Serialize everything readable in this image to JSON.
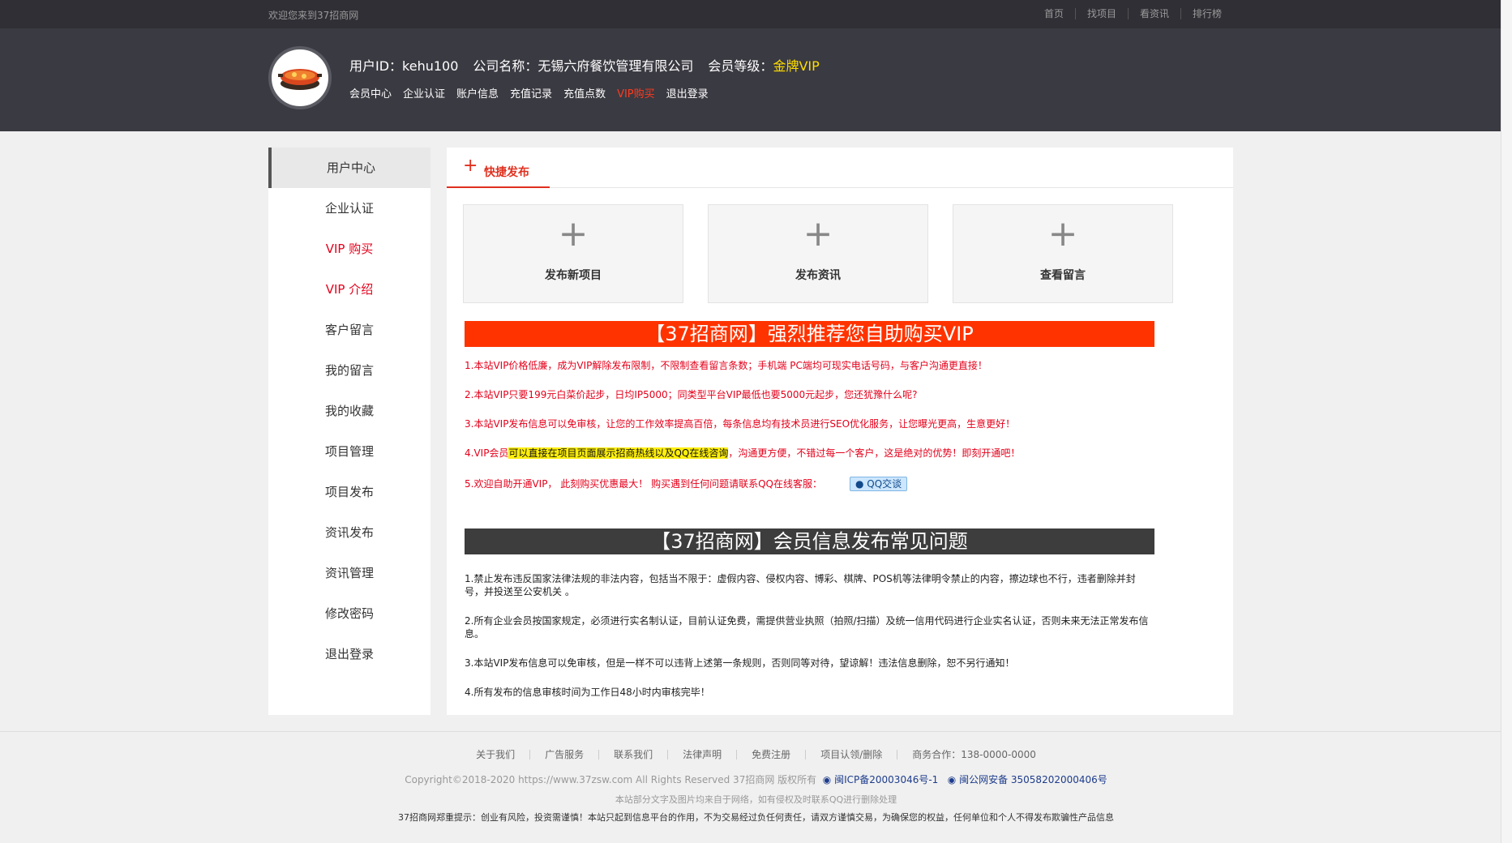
{
  "topbar": {
    "welcome": "欢迎您来到37招商网",
    "nav": [
      "首页",
      "找项目",
      "看资讯",
      "排行榜"
    ]
  },
  "header": {
    "user_id_label": "用户ID：kehu100",
    "company_label": "公司名称：无锡六府餐饮管理有限公司",
    "level_label": "会员等级：",
    "level_value": "金牌VIP",
    "nav": [
      "会员中心",
      "企业认证",
      "账户信息",
      "充值记录",
      "充值点数",
      "VIP购买",
      "退出登录"
    ]
  },
  "sidebar": {
    "items": [
      "用户中心",
      "企业认证",
      "VIP 购买",
      "VIP 介绍",
      "客户留言",
      "我的留言",
      "我的收藏",
      "项目管理",
      "项目发布",
      "资讯发布",
      "资讯管理",
      "修改密码",
      "退出登录"
    ]
  },
  "main": {
    "tab_plus": "+",
    "tab_label": "快捷发布",
    "cards": [
      "发布新项目",
      "发布资讯",
      "查看留言"
    ],
    "banner1": "【37招商网】强烈推荐您自助购买VIP",
    "points": {
      "p1": "1.本站VIP价格低廉，成为VIP解除发布限制，不限制查看留言条数；手机端 PC端均可现实电话号码，与客户沟通更直接！",
      "p2": "2.本站VIP只要199元白菜价起步，日均IP5000；同类型平台VIP最低也要5000元起步，您还犹豫什么呢?",
      "p3": "3.本站VIP发布信息可以免审核，让您的工作效率提高百倍，每条信息均有技术员进行SEO优化服务，让您曝光更高，生意更好！",
      "p4a": "4.VIP会员",
      "p4b": "可以直接在项目页面展示招商热线以及QQ在线咨询",
      "p4c": "，沟通更方便，不错过每一个客户，这是绝对的优势！即刻开通吧！",
      "p5": "5.欢迎自助开通VIP， 此刻购买优惠最大！ 购买遇到任何问题请联系QQ在线客服：",
      "qq_btn": "QQ交谈"
    },
    "banner2": "【37招商网】会员信息发布常见问题",
    "rules": [
      "1.禁止发布违反国家法律法规的非法内容，包括当不限于：虚假内容、侵权内容、博彩、棋牌、POS机等法律明令禁止的内容，擦边球也不行，违者删除并封号，并投送至公安机关 。",
      "2.所有企业会员按国家规定，必须进行实名制认证，目前认证免费，需提供营业执照（拍照/扫描）及统一信用代码进行企业实名认证，否则未来无法正常发布信息。",
      "3.本站VIP发布信息可以免审核，但是一样不可以违背上述第一条规则，否则同等对待，望谅解！违法信息删除，恕不另行通知！",
      "4.所有发布的信息审核时间为工作日48小时内审核完毕！"
    ]
  },
  "footer": {
    "links": [
      "关于我们",
      "广告服务",
      "联系我们",
      "法律声明",
      "免费注册",
      "项目认领/删除",
      "商务合作：138-0000-0000"
    ],
    "copyright": "Copyright©2018-2020 https://www.37zsw.com All Rights Reserved 37招商网 版权所有",
    "icp": "闽ICP备20003046号-1",
    "police": "闽公网安备 35058202000406号",
    "note1": "本站部分文字及图片均来自于网络，如有侵权及时联系QQ进行删除处理",
    "note2": "37招商网郑重提示：创业有风险，投资需谨慎！本站只起到信息平台的作用，不为交易经过负任何责任，请双方谨慎交易，为确保您的权益，任何单位和个人不得发布欺骗性产品信息"
  },
  "colors": {
    "accent": "#e0301e",
    "vip_gold": "#ffde00",
    "header_bg": "#3a3a42"
  }
}
